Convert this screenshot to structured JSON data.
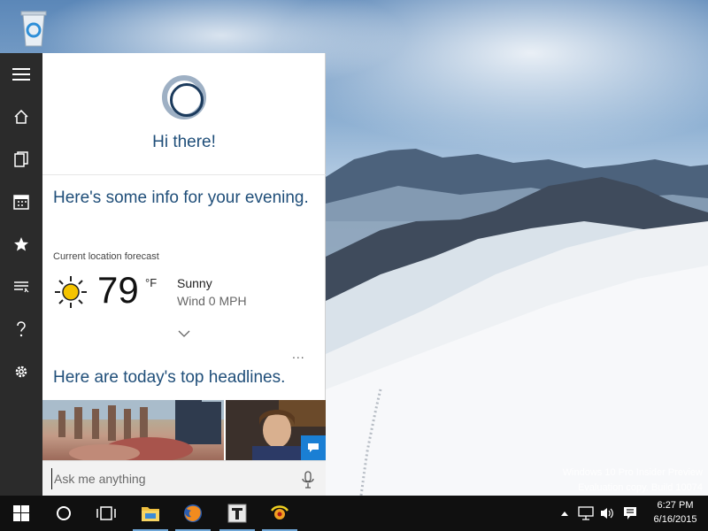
{
  "cortana": {
    "greeting": "Hi there!",
    "info_title": "Here's some info for your evening.",
    "forecast_label": "Current location forecast",
    "weather": {
      "temperature": "79",
      "unit": "°F",
      "condition": "Sunny",
      "wind": "Wind 0 MPH"
    },
    "more_label": "...",
    "headlines_title": "Here are today's top headlines.",
    "search_placeholder": "Ask me anything"
  },
  "rail": {
    "items": [
      {
        "name": "menu-icon"
      },
      {
        "name": "home-icon"
      },
      {
        "name": "notebook-icon"
      },
      {
        "name": "calendar-icon"
      },
      {
        "name": "star-icon"
      },
      {
        "name": "feedback-icon"
      },
      {
        "name": "help-icon"
      },
      {
        "name": "settings-icon"
      }
    ]
  },
  "desktop": {
    "watermark_line1": "Windows 10 Pro Insider Preview",
    "watermark_line2": "Evaluation copy. Build 10074"
  },
  "taskbar": {
    "apps": [
      "start-icon",
      "cortana-icon",
      "task-view-icon",
      "file-explorer-icon",
      "firefox-icon",
      "typora-icon",
      "sun-app-icon"
    ],
    "clock_time": "6:27 PM",
    "clock_date": "6/16/2015"
  },
  "colors": {
    "accent": "#1f4e79",
    "rail_bg": "#2b2b2b",
    "taskbar_bg": "#101010"
  }
}
